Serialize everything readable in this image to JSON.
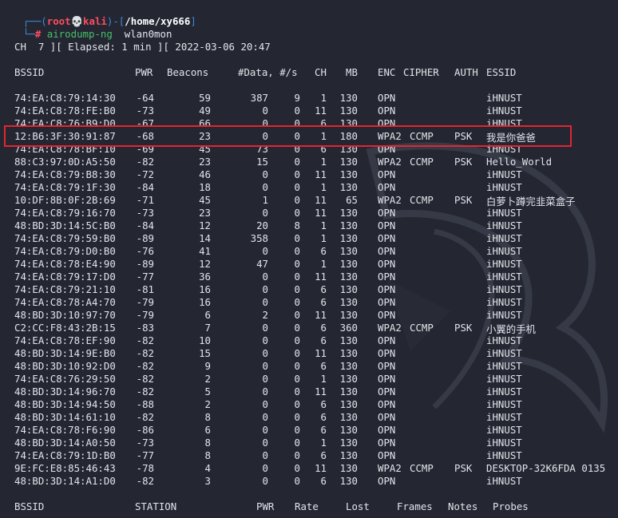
{
  "prompt": {
    "user": "root",
    "skull": "💀",
    "host": "kali",
    "path": "/home/xy666",
    "command": "airodump-ng",
    "argument": "wlan0mon"
  },
  "status_line": "CH  7 ][ Elapsed: 1 min ][ 2022-03-06 20:47",
  "ap_headers": [
    "BSSID",
    "PWR",
    "Beacons",
    "#Data, #/s",
    "CH",
    "MB",
    "ENC",
    "CIPHER",
    "AUTH",
    "ESSID"
  ],
  "ap_rows": [
    {
      "bssid": "74:EA:C8:79:14:30",
      "pwr": "-64",
      "beacons": "59",
      "data": "387",
      "ps": "9",
      "ch": "1",
      "mb": "130",
      "enc": "OPN",
      "cipher": "",
      "auth": "",
      "essid": "iHNUST"
    },
    {
      "bssid": "74:EA:C8:78:FE:B0",
      "pwr": "-73",
      "beacons": "49",
      "data": "0",
      "ps": "0",
      "ch": "11",
      "mb": "130",
      "enc": "OPN",
      "cipher": "",
      "auth": "",
      "essid": "iHNUST"
    },
    {
      "bssid": "74:EA:C8:76:B9:D0",
      "pwr": "-67",
      "beacons": "66",
      "data": "0",
      "ps": "0",
      "ch": "6",
      "mb": "130",
      "enc": "OPN",
      "cipher": "",
      "auth": "",
      "essid": "iHNUST"
    },
    {
      "bssid": "12:B6:3F:30:91:87",
      "pwr": "-68",
      "beacons": "23",
      "data": "0",
      "ps": "0",
      "ch": "1",
      "mb": "180",
      "enc": "WPA2",
      "cipher": "CCMP",
      "auth": "PSK",
      "essid": "我是你爸爸"
    },
    {
      "bssid": "74:EA:C8:78:BF:10",
      "pwr": "-69",
      "beacons": "45",
      "data": "73",
      "ps": "0",
      "ch": "6",
      "mb": "130",
      "enc": "OPN",
      "cipher": "",
      "auth": "",
      "essid": "iHNUST"
    },
    {
      "bssid": "88:C3:97:0D:A5:50",
      "pwr": "-82",
      "beacons": "23",
      "data": "15",
      "ps": "0",
      "ch": "1",
      "mb": "130",
      "enc": "WPA2",
      "cipher": "CCMP",
      "auth": "PSK",
      "essid": "Hello_World"
    },
    {
      "bssid": "74:EA:C8:79:B8:30",
      "pwr": "-72",
      "beacons": "46",
      "data": "0",
      "ps": "0",
      "ch": "11",
      "mb": "130",
      "enc": "OPN",
      "cipher": "",
      "auth": "",
      "essid": "iHNUST"
    },
    {
      "bssid": "74:EA:C8:79:1F:30",
      "pwr": "-84",
      "beacons": "18",
      "data": "0",
      "ps": "0",
      "ch": "1",
      "mb": "130",
      "enc": "OPN",
      "cipher": "",
      "auth": "",
      "essid": "iHNUST"
    },
    {
      "bssid": "10:DF:8B:0F:2B:69",
      "pwr": "-71",
      "beacons": "45",
      "data": "1",
      "ps": "0",
      "ch": "11",
      "mb": "65",
      "enc": "WPA2",
      "cipher": "CCMP",
      "auth": "PSK",
      "essid": "白萝卜蹲完韭菜盒子"
    },
    {
      "bssid": "74:EA:C8:79:16:70",
      "pwr": "-73",
      "beacons": "23",
      "data": "0",
      "ps": "0",
      "ch": "11",
      "mb": "130",
      "enc": "OPN",
      "cipher": "",
      "auth": "",
      "essid": "iHNUST"
    },
    {
      "bssid": "48:BD:3D:14:5C:B0",
      "pwr": "-84",
      "beacons": "12",
      "data": "20",
      "ps": "8",
      "ch": "1",
      "mb": "130",
      "enc": "OPN",
      "cipher": "",
      "auth": "",
      "essid": "iHNUST"
    },
    {
      "bssid": "74:EA:C8:79:59:B0",
      "pwr": "-89",
      "beacons": "14",
      "data": "358",
      "ps": "0",
      "ch": "1",
      "mb": "130",
      "enc": "OPN",
      "cipher": "",
      "auth": "",
      "essid": "iHNUST"
    },
    {
      "bssid": "74:EA:C8:79:D0:B0",
      "pwr": "-76",
      "beacons": "41",
      "data": "0",
      "ps": "0",
      "ch": "6",
      "mb": "130",
      "enc": "OPN",
      "cipher": "",
      "auth": "",
      "essid": "iHNUST"
    },
    {
      "bssid": "74:EA:C8:78:E4:90",
      "pwr": "-89",
      "beacons": "12",
      "data": "47",
      "ps": "0",
      "ch": "1",
      "mb": "130",
      "enc": "OPN",
      "cipher": "",
      "auth": "",
      "essid": "iHNUST"
    },
    {
      "bssid": "74:EA:C8:79:17:D0",
      "pwr": "-77",
      "beacons": "36",
      "data": "0",
      "ps": "0",
      "ch": "11",
      "mb": "130",
      "enc": "OPN",
      "cipher": "",
      "auth": "",
      "essid": "iHNUST"
    },
    {
      "bssid": "74:EA:C8:79:21:10",
      "pwr": "-81",
      "beacons": "16",
      "data": "0",
      "ps": "0",
      "ch": "6",
      "mb": "130",
      "enc": "OPN",
      "cipher": "",
      "auth": "",
      "essid": "iHNUST"
    },
    {
      "bssid": "74:EA:C8:78:A4:70",
      "pwr": "-79",
      "beacons": "16",
      "data": "0",
      "ps": "0",
      "ch": "6",
      "mb": "130",
      "enc": "OPN",
      "cipher": "",
      "auth": "",
      "essid": "iHNUST"
    },
    {
      "bssid": "48:BD:3D:10:97:70",
      "pwr": "-79",
      "beacons": "6",
      "data": "2",
      "ps": "0",
      "ch": "11",
      "mb": "130",
      "enc": "OPN",
      "cipher": "",
      "auth": "",
      "essid": "iHNUST"
    },
    {
      "bssid": "C2:CC:F8:43:2B:15",
      "pwr": "-83",
      "beacons": "7",
      "data": "0",
      "ps": "0",
      "ch": "6",
      "mb": "360",
      "enc": "WPA2",
      "cipher": "CCMP",
      "auth": "PSK",
      "essid": "小翼的手机"
    },
    {
      "bssid": "74:EA:C8:78:EF:90",
      "pwr": "-82",
      "beacons": "10",
      "data": "0",
      "ps": "0",
      "ch": "6",
      "mb": "130",
      "enc": "OPN",
      "cipher": "",
      "auth": "",
      "essid": "iHNUST"
    },
    {
      "bssid": "48:BD:3D:14:9E:B0",
      "pwr": "-82",
      "beacons": "15",
      "data": "0",
      "ps": "0",
      "ch": "11",
      "mb": "130",
      "enc": "OPN",
      "cipher": "",
      "auth": "",
      "essid": "iHNUST"
    },
    {
      "bssid": "48:BD:3D:10:92:D0",
      "pwr": "-82",
      "beacons": "9",
      "data": "0",
      "ps": "0",
      "ch": "6",
      "mb": "130",
      "enc": "OPN",
      "cipher": "",
      "auth": "",
      "essid": "iHNUST"
    },
    {
      "bssid": "74:EA:C8:76:29:50",
      "pwr": "-82",
      "beacons": "2",
      "data": "0",
      "ps": "0",
      "ch": "1",
      "mb": "130",
      "enc": "OPN",
      "cipher": "",
      "auth": "",
      "essid": "iHNUST"
    },
    {
      "bssid": "48:BD:3D:14:96:70",
      "pwr": "-82",
      "beacons": "5",
      "data": "0",
      "ps": "0",
      "ch": "11",
      "mb": "130",
      "enc": "OPN",
      "cipher": "",
      "auth": "",
      "essid": "iHNUST"
    },
    {
      "bssid": "48:BD:3D:14:94:50",
      "pwr": "-88",
      "beacons": "2",
      "data": "0",
      "ps": "0",
      "ch": "6",
      "mb": "130",
      "enc": "OPN",
      "cipher": "",
      "auth": "",
      "essid": "iHNUST"
    },
    {
      "bssid": "48:BD:3D:14:61:10",
      "pwr": "-82",
      "beacons": "8",
      "data": "0",
      "ps": "0",
      "ch": "6",
      "mb": "130",
      "enc": "OPN",
      "cipher": "",
      "auth": "",
      "essid": "iHNUST"
    },
    {
      "bssid": "74:EA:C8:78:F6:90",
      "pwr": "-86",
      "beacons": "6",
      "data": "0",
      "ps": "0",
      "ch": "6",
      "mb": "130",
      "enc": "OPN",
      "cipher": "",
      "auth": "",
      "essid": "iHNUST"
    },
    {
      "bssid": "48:BD:3D:14:A0:50",
      "pwr": "-73",
      "beacons": "8",
      "data": "0",
      "ps": "0",
      "ch": "1",
      "mb": "130",
      "enc": "OPN",
      "cipher": "",
      "auth": "",
      "essid": "iHNUST"
    },
    {
      "bssid": "74:EA:C8:79:1D:B0",
      "pwr": "-77",
      "beacons": "8",
      "data": "0",
      "ps": "0",
      "ch": "6",
      "mb": "130",
      "enc": "OPN",
      "cipher": "",
      "auth": "",
      "essid": "iHNUST"
    },
    {
      "bssid": "9E:FC:E8:85:46:43",
      "pwr": "-78",
      "beacons": "4",
      "data": "0",
      "ps": "0",
      "ch": "11",
      "mb": "130",
      "enc": "WPA2",
      "cipher": "CCMP",
      "auth": "PSK",
      "essid": "DESKTOP-32K6FDA 0135"
    },
    {
      "bssid": "48:BD:3D:14:A1:D0",
      "pwr": "-82",
      "beacons": "3",
      "data": "0",
      "ps": "0",
      "ch": "6",
      "mb": "130",
      "enc": "OPN",
      "cipher": "",
      "auth": "",
      "essid": "iHNUST"
    }
  ],
  "station_headers": [
    "BSSID",
    "STATION",
    "PWR",
    "Rate",
    "Lost",
    "Frames",
    "Notes",
    "Probes"
  ],
  "colors": {
    "background": "#242632",
    "text": "#e3e5ea",
    "prompt_bracket": "#3d8bd9",
    "prompt_user": "#ff4d5e",
    "command": "#46c06a",
    "highlight_box": "#e4252f"
  }
}
